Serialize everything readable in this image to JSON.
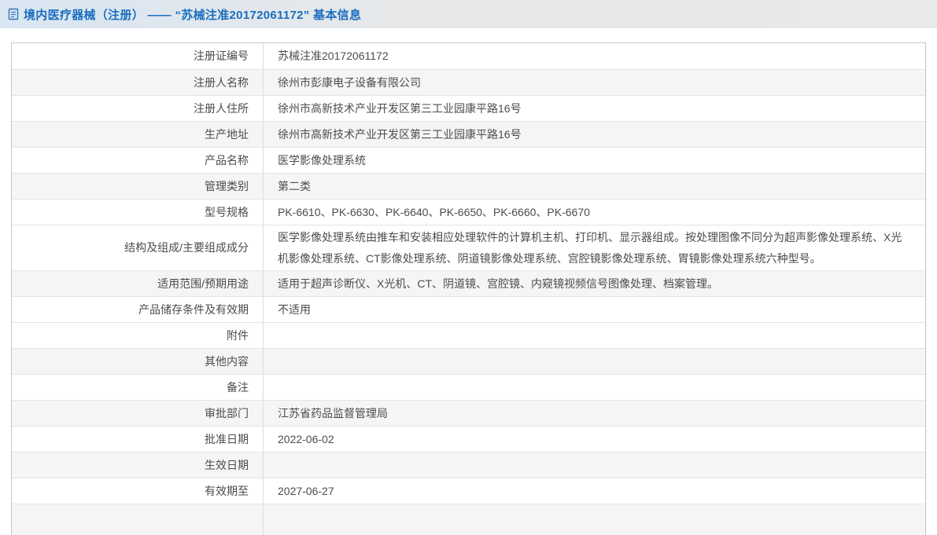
{
  "header": {
    "title": "境内医疗器械（注册） —— “苏械注准20172061172” 基本信息",
    "icon": "document-icon",
    "title_color": "#1a6dbd",
    "bar_background": "#e3e9ee"
  },
  "table": {
    "alt_row_background": "#f5f5f6",
    "border_color": "#c6c8ca",
    "rows": [
      {
        "label": "注册证编号",
        "value": "苏械注准20172061172"
      },
      {
        "label": "注册人名称",
        "value": "徐州市彭康电子设备有限公司"
      },
      {
        "label": "注册人住所",
        "value": "徐州市高新技术产业开发区第三工业园康平路16号"
      },
      {
        "label": "生产地址",
        "value": "徐州市高新技术产业开发区第三工业园康平路16号"
      },
      {
        "label": "产品名称",
        "value": "医学影像处理系统"
      },
      {
        "label": "管理类别",
        "value": "第二类"
      },
      {
        "label": "型号规格",
        "value": "PK-6610、PK-6630、PK-6640、PK-6650、PK-6660、PK-6670"
      },
      {
        "label": "结构及组成/主要组成成分",
        "value": "医学影像处理系统由推车和安装相应处理软件的计算机主机、打印机、显示器组成。按处理图像不同分为超声影像处理系统、X光机影像处理系统、CT影像处理系统、阴道镜影像处理系统、宫腔镜影像处理系统、胃镜影像处理系统六种型号。"
      },
      {
        "label": "适用范围/预期用途",
        "value": "适用于超声诊断仪、X光机、CT、阴道镜、宫腔镜、内窥镜视频信号图像处理、档案管理。"
      },
      {
        "label": "产品储存条件及有效期",
        "value": "不适用"
      },
      {
        "label": "附件",
        "value": ""
      },
      {
        "label": "其他内容",
        "value": ""
      },
      {
        "label": "备注",
        "value": ""
      },
      {
        "label": "审批部门",
        "value": "江苏省药品监督管理局"
      },
      {
        "label": "批准日期",
        "value": "2022-06-02"
      },
      {
        "label": "生效日期",
        "value": ""
      },
      {
        "label": "有效期至",
        "value": "2027-06-27"
      }
    ]
  }
}
